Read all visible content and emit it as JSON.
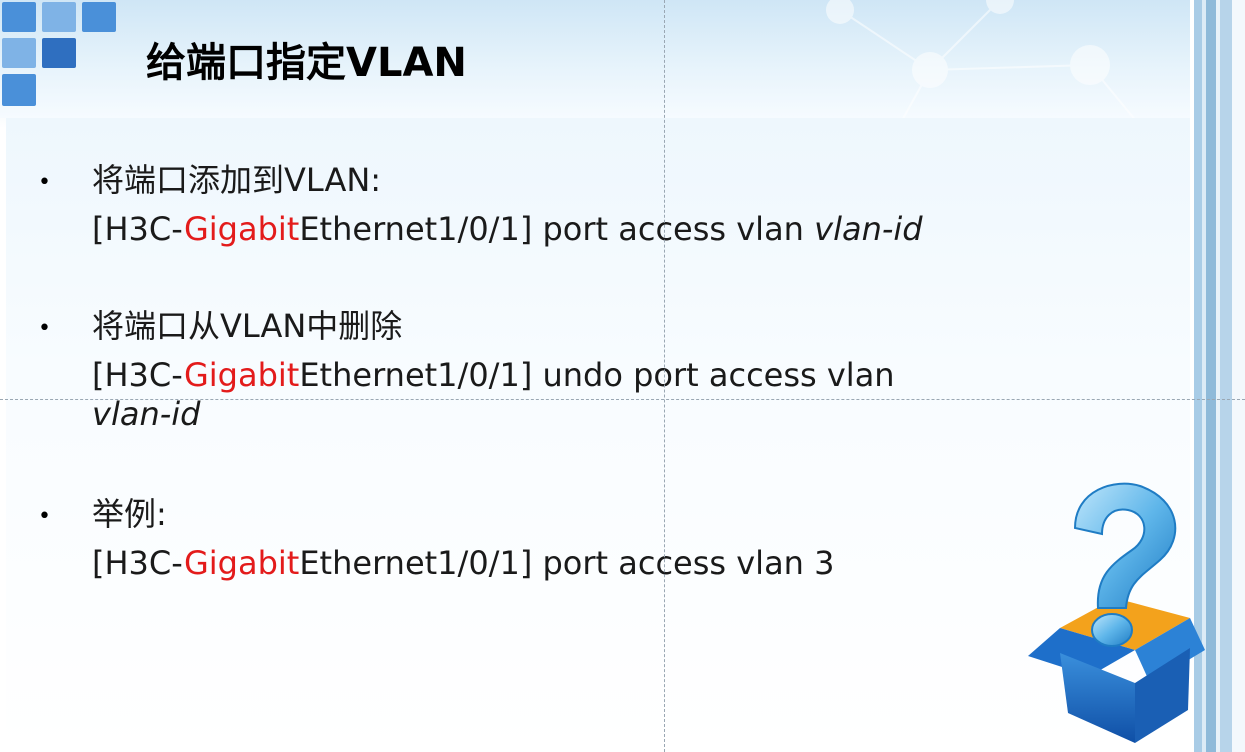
{
  "slide": {
    "title": "给端口指定VLAN"
  },
  "bullets": [
    {
      "heading": "将端口添加到VLAN:",
      "command": {
        "prefix": "[H3C-",
        "highlight": "Gigabit",
        "rest": "Ethernet1/0/1] port access vlan ",
        "param": "vlan-id"
      }
    },
    {
      "heading": "将端口从VLAN中删除",
      "command": {
        "prefix": "[H3C-",
        "highlight": "Gigabit",
        "rest": "Ethernet1/0/1] undo port access vlan",
        "param": "vlan-id"
      }
    },
    {
      "heading": "举例:",
      "command": {
        "prefix": "[H3C-",
        "highlight": "Gigabit",
        "rest": "Ethernet1/0/1] port access vlan 3"
      }
    }
  ],
  "decor": {
    "bullet_symbol": "•",
    "highlight_color": "#e31b1b",
    "logo_colors": [
      "#4a90d9",
      "#7fb3e6",
      "#2f6fc0"
    ],
    "illustration": "question-mark-box-icon"
  }
}
